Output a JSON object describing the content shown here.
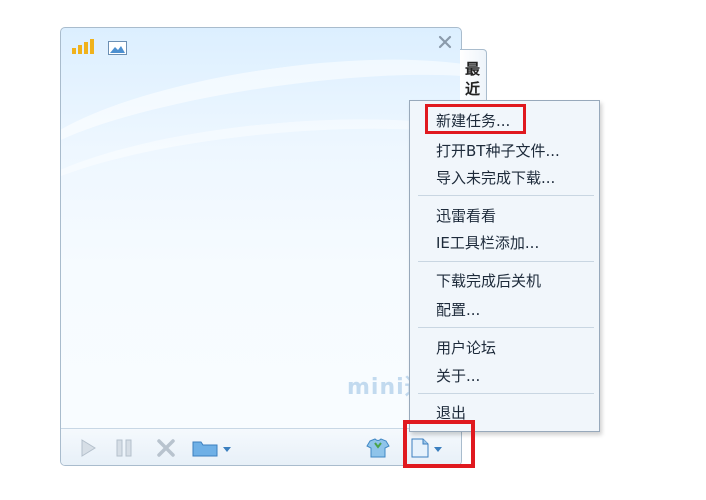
{
  "side_tab": {
    "label_line1": "最",
    "label_line2": "近"
  },
  "watermark": "mini迅雷",
  "menu": {
    "items": [
      {
        "label": "新建任务..."
      },
      {
        "label": "打开BT种子文件..."
      },
      {
        "label": "导入未完成下载..."
      },
      {
        "label": "迅雷看看"
      },
      {
        "label": "IE工具栏添加..."
      },
      {
        "label": "下载完成后关机"
      },
      {
        "label": "配置..."
      },
      {
        "label": "用户论坛"
      },
      {
        "label": "关于..."
      },
      {
        "label": "退出"
      }
    ]
  },
  "icons": {
    "signal": "signal-bars-icon",
    "picture": "picture-icon",
    "close": "close-icon",
    "play": "play-icon",
    "pause": "pause-icon",
    "delete": "delete-icon",
    "folder": "folder-dropdown-icon",
    "tshirt": "tshirt-icon",
    "new_task": "new-task-dropdown-icon"
  },
  "colors": {
    "highlight": "#e0191f",
    "menu_bg": "#f1f6fb",
    "accent": "#3d8fd6"
  }
}
